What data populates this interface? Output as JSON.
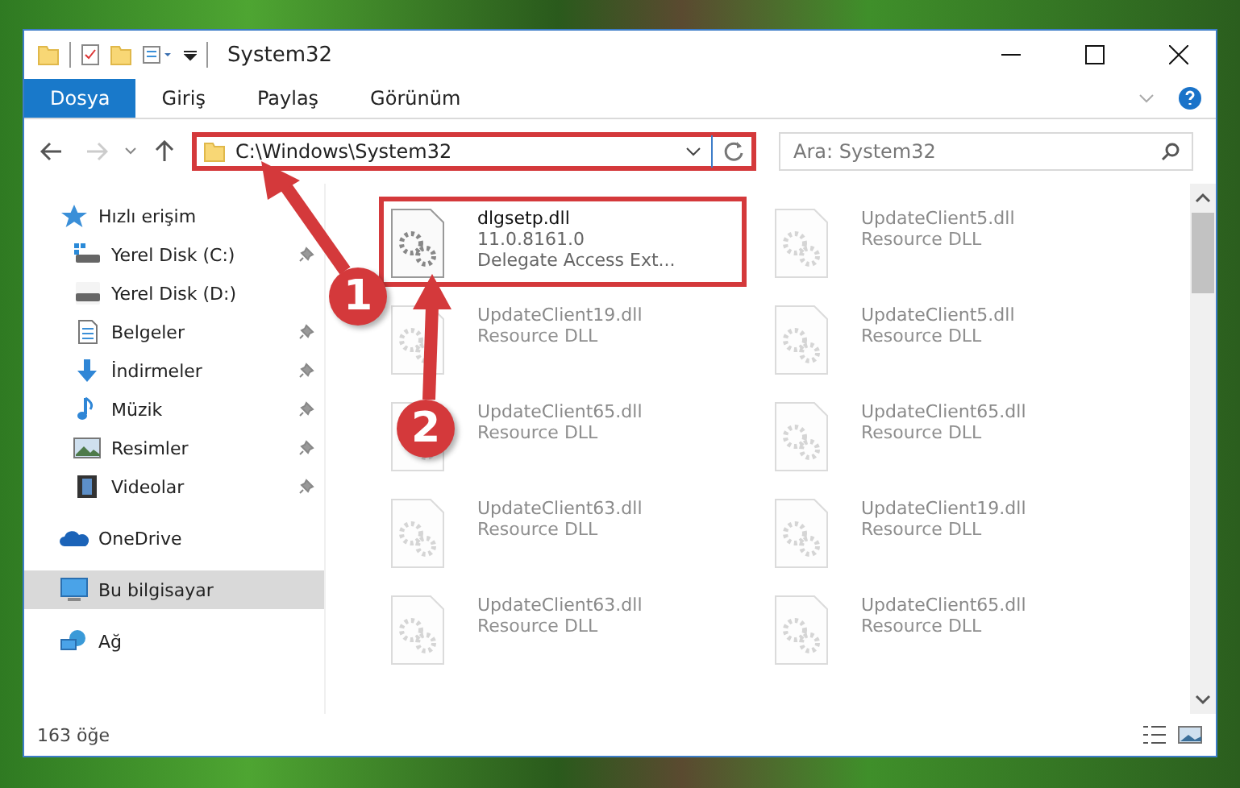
{
  "window": {
    "title": "System32"
  },
  "ribbon_tabs": [
    {
      "label": "Dosya",
      "selected": true
    },
    {
      "label": "Giriş",
      "selected": false
    },
    {
      "label": "Paylaş",
      "selected": false
    },
    {
      "label": "Görünüm",
      "selected": false
    }
  ],
  "address": {
    "path": "C:\\Windows\\System32",
    "highlighted": true
  },
  "search": {
    "placeholder": "Ara: System32"
  },
  "nav": [
    {
      "label": "Hızlı erişim",
      "kind": "star",
      "selected": false,
      "children": [
        {
          "label": "Yerel Disk (C:)",
          "kind": "drive-win",
          "pinned": true,
          "selected": false
        },
        {
          "label": "Yerel Disk (D:)",
          "kind": "drive",
          "pinned": false,
          "selected": false
        },
        {
          "label": "Belgeler",
          "kind": "docs",
          "pinned": true,
          "selected": false
        },
        {
          "label": "İndirmeler",
          "kind": "download",
          "pinned": true,
          "selected": false
        },
        {
          "label": "Müzik",
          "kind": "music",
          "pinned": true,
          "selected": false
        },
        {
          "label": "Resimler",
          "kind": "pictures",
          "pinned": true,
          "selected": false
        },
        {
          "label": "Videolar",
          "kind": "videos",
          "pinned": true,
          "selected": false
        }
      ]
    },
    {
      "label": "OneDrive",
      "kind": "cloud",
      "selected": false
    },
    {
      "label": "Bu bilgisayar",
      "kind": "pc",
      "selected": true
    },
    {
      "label": "Ağ",
      "kind": "network",
      "selected": false
    }
  ],
  "files": [
    {
      "name": "dlgsetp.dll",
      "details": [
        "11.0.8161.0",
        "Delegate Access Ext..."
      ],
      "highlighted": true,
      "faded": false
    },
    {
      "name": "UpdateClient5.dll",
      "details": [
        "Resource DLL"
      ],
      "highlighted": false,
      "faded": true
    },
    {
      "name": "UpdateClient19.dll",
      "details": [
        "Resource DLL"
      ],
      "highlighted": false,
      "faded": true
    },
    {
      "name": "UpdateClient5.dll",
      "details": [
        "Resource DLL"
      ],
      "highlighted": false,
      "faded": true
    },
    {
      "name": "UpdateClient65.dll",
      "details": [
        "Resource DLL"
      ],
      "highlighted": false,
      "faded": true
    },
    {
      "name": "UpdateClient65.dll",
      "details": [
        "Resource DLL"
      ],
      "highlighted": false,
      "faded": true
    },
    {
      "name": "UpdateClient63.dll",
      "details": [
        "Resource DLL"
      ],
      "highlighted": false,
      "faded": true
    },
    {
      "name": "UpdateClient19.dll",
      "details": [
        "Resource DLL"
      ],
      "highlighted": false,
      "faded": true
    },
    {
      "name": "UpdateClient63.dll",
      "details": [
        "Resource DLL"
      ],
      "highlighted": false,
      "faded": true
    },
    {
      "name": "UpdateClient65.dll",
      "details": [
        "Resource DLL"
      ],
      "highlighted": false,
      "faded": true
    }
  ],
  "status_bar": {
    "count": "163 öğe"
  },
  "annotations": [
    {
      "label": "1"
    },
    {
      "label": "2"
    }
  ]
}
